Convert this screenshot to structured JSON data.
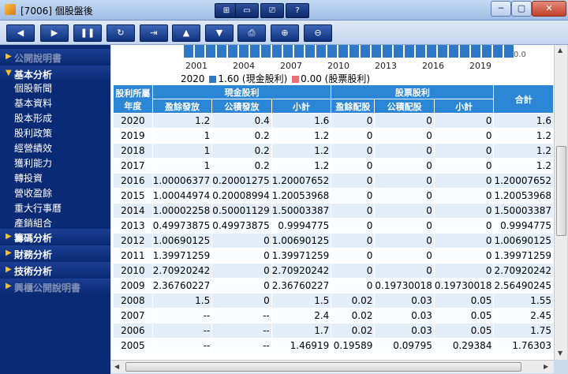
{
  "window": {
    "title": "[7006] 個股盤後"
  },
  "titlebar_buttons": [
    "⊞",
    "▭",
    "⎚",
    "?"
  ],
  "toolbar": [
    {
      "icon": "back-icon",
      "glyph": "◀"
    },
    {
      "icon": "play-icon",
      "glyph": "▶"
    },
    {
      "icon": "pause-icon",
      "glyph": "❚❚"
    },
    {
      "icon": "refresh-icon",
      "glyph": "↻"
    },
    {
      "icon": "export-icon",
      "glyph": "⇥"
    },
    {
      "icon": "up-icon",
      "glyph": "▲"
    },
    {
      "icon": "down-icon",
      "glyph": "▼"
    },
    {
      "icon": "print-icon",
      "glyph": "⎙"
    },
    {
      "icon": "zoom-in-icon",
      "glyph": "⊕"
    },
    {
      "icon": "zoom-out-icon",
      "glyph": "⊖"
    }
  ],
  "sidebar": {
    "sections": [
      {
        "label": "公開說明書",
        "dim": true
      },
      {
        "label": "基本分析",
        "dim": false
      },
      {
        "label": "籌碼分析",
        "dim": false
      },
      {
        "label": "財務分析",
        "dim": false
      },
      {
        "label": "技術分析",
        "dim": false
      },
      {
        "label": "興櫃公開說明書",
        "dim": true
      }
    ],
    "sub_items": [
      "個股新聞",
      "基本資料",
      "股本形成",
      "股利政策",
      "經營績效",
      "獲利能力",
      "轉投資",
      "營收盈餘",
      "重大行事曆",
      "產銷組合"
    ]
  },
  "chart": {
    "x_ticks": [
      "2001",
      "2004",
      "2007",
      "2010",
      "2013",
      "2016",
      "2019"
    ],
    "zero_label": "0.0",
    "legend_year": "2020",
    "legend_items": [
      {
        "value": "1.60",
        "label": "(現金股利)",
        "color": "#2f78c8"
      },
      {
        "value": "0.00",
        "label": "(股票股利)",
        "color": "#e8707a"
      }
    ]
  },
  "table": {
    "header_year": "股利所屬年度",
    "group_cash": "現金股利",
    "group_stock": "股票股利",
    "header_total": "合計",
    "sub_headers": [
      "盈餘發放",
      "公積發放",
      "小計",
      "盈餘配股",
      "公積配股",
      "小計"
    ],
    "rows": [
      [
        "2020",
        "1.2",
        "0.4",
        "1.6",
        "0",
        "0",
        "0",
        "1.6"
      ],
      [
        "2019",
        "1",
        "0.2",
        "1.2",
        "0",
        "0",
        "0",
        "1.2"
      ],
      [
        "2018",
        "1",
        "0.2",
        "1.2",
        "0",
        "0",
        "0",
        "1.2"
      ],
      [
        "2017",
        "1",
        "0.2",
        "1.2",
        "0",
        "0",
        "0",
        "1.2"
      ],
      [
        "2016",
        "1.00006377",
        "0.20001275",
        "1.20007652",
        "0",
        "0",
        "0",
        "1.20007652"
      ],
      [
        "2015",
        "1.00044974",
        "0.20008994",
        "1.20053968",
        "0",
        "0",
        "0",
        "1.20053968"
      ],
      [
        "2014",
        "1.00002258",
        "0.50001129",
        "1.50003387",
        "0",
        "0",
        "0",
        "1.50003387"
      ],
      [
        "2013",
        "0.49973875",
        "0.49973875",
        "0.9994775",
        "0",
        "0",
        "0",
        "0.9994775"
      ],
      [
        "2012",
        "1.00690125",
        "0",
        "1.00690125",
        "0",
        "0",
        "0",
        "1.00690125"
      ],
      [
        "2011",
        "1.39971259",
        "0",
        "1.39971259",
        "0",
        "0",
        "0",
        "1.39971259"
      ],
      [
        "2010",
        "2.70920242",
        "0",
        "2.70920242",
        "0",
        "0",
        "0",
        "2.70920242"
      ],
      [
        "2009",
        "2.36760227",
        "0",
        "2.36760227",
        "0",
        "0.19730018",
        "0.19730018",
        "2.56490245"
      ],
      [
        "2008",
        "1.5",
        "0",
        "1.5",
        "0.02",
        "0.03",
        "0.05",
        "1.55"
      ],
      [
        "2007",
        "--",
        "--",
        "2.4",
        "0.02",
        "0.03",
        "0.05",
        "2.45"
      ],
      [
        "2006",
        "--",
        "--",
        "1.7",
        "0.02",
        "0.03",
        "0.05",
        "1.75"
      ],
      [
        "2005",
        "--",
        "--",
        "1.46919",
        "0.19589",
        "0.09795",
        "0.29384",
        "1.76303"
      ]
    ]
  }
}
